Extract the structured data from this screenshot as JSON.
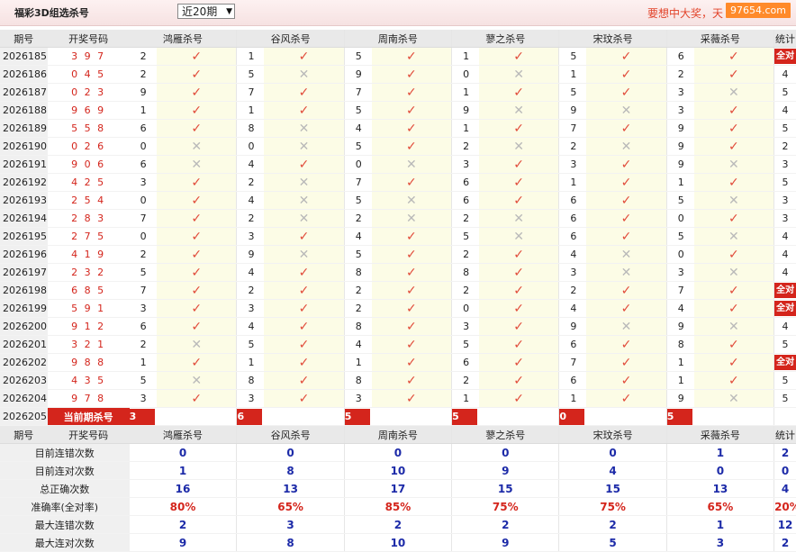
{
  "header": {
    "title": "福彩3D组选杀号",
    "period_select": "近20期",
    "slogan": "要想中大奖，天",
    "site": "97654.com"
  },
  "columns": {
    "period": "期号",
    "code": "开奖号码",
    "groups": [
      "鸿雁杀号",
      "谷风杀号",
      "周南杀号",
      "蓼之杀号",
      "宋玟杀号",
      "采薇杀号"
    ],
    "total": "统计"
  },
  "icons": {
    "right": "check-icon",
    "wrong": "cross-icon"
  },
  "labels": {
    "all_right": "全对",
    "current": "当前期杀号"
  },
  "rows": [
    {
      "period": "2026185",
      "code": "3 9 7",
      "kills": [
        2,
        1,
        5,
        1,
        5,
        6
      ],
      "marks": [
        1,
        1,
        1,
        1,
        1,
        1
      ],
      "total": "全对",
      "all": true
    },
    {
      "period": "2026186",
      "code": "0 4 5",
      "kills": [
        2,
        5,
        9,
        0,
        1,
        2
      ],
      "marks": [
        1,
        0,
        1,
        0,
        1,
        1
      ],
      "total": "4"
    },
    {
      "period": "2026187",
      "code": "0 2 3",
      "kills": [
        9,
        7,
        7,
        1,
        5,
        3
      ],
      "marks": [
        1,
        1,
        1,
        1,
        1,
        0
      ],
      "total": "5"
    },
    {
      "period": "2026188",
      "code": "9 6 9",
      "kills": [
        1,
        1,
        5,
        9,
        9,
        3
      ],
      "marks": [
        1,
        1,
        1,
        0,
        0,
        1
      ],
      "total": "4"
    },
    {
      "period": "2026189",
      "code": "5 5 8",
      "kills": [
        6,
        8,
        4,
        1,
        7,
        9
      ],
      "marks": [
        1,
        0,
        1,
        1,
        1,
        1
      ],
      "total": "5"
    },
    {
      "period": "2026190",
      "code": "0 2 6",
      "kills": [
        0,
        0,
        5,
        2,
        2,
        9
      ],
      "marks": [
        0,
        0,
        1,
        0,
        0,
        1
      ],
      "total": "2"
    },
    {
      "period": "2026191",
      "code": "9 0 6",
      "kills": [
        6,
        4,
        0,
        3,
        3,
        9
      ],
      "marks": [
        0,
        1,
        0,
        1,
        1,
        0
      ],
      "total": "3"
    },
    {
      "period": "2026192",
      "code": "4 2 5",
      "kills": [
        3,
        2,
        7,
        6,
        1,
        1
      ],
      "marks": [
        1,
        0,
        1,
        1,
        1,
        1
      ],
      "total": "5"
    },
    {
      "period": "2026193",
      "code": "2 5 4",
      "kills": [
        0,
        4,
        5,
        6,
        6,
        5
      ],
      "marks": [
        1,
        0,
        0,
        1,
        1,
        0
      ],
      "total": "3"
    },
    {
      "period": "2026194",
      "code": "2 8 3",
      "kills": [
        7,
        2,
        2,
        2,
        6,
        0
      ],
      "marks": [
        1,
        0,
        0,
        0,
        1,
        1
      ],
      "total": "3"
    },
    {
      "period": "2026195",
      "code": "2 7 5",
      "kills": [
        0,
        3,
        4,
        5,
        6,
        5
      ],
      "marks": [
        1,
        1,
        1,
        0,
        1,
        0
      ],
      "total": "4"
    },
    {
      "period": "2026196",
      "code": "4 1 9",
      "kills": [
        2,
        9,
        5,
        2,
        4,
        0
      ],
      "marks": [
        1,
        0,
        1,
        1,
        0,
        1
      ],
      "total": "4"
    },
    {
      "period": "2026197",
      "code": "2 3 2",
      "kills": [
        5,
        4,
        8,
        8,
        3,
        3
      ],
      "marks": [
        1,
        1,
        1,
        1,
        0,
        0
      ],
      "total": "4"
    },
    {
      "period": "2026198",
      "code": "6 8 5",
      "kills": [
        7,
        2,
        2,
        2,
        2,
        7
      ],
      "marks": [
        1,
        1,
        1,
        1,
        1,
        1
      ],
      "total": "全对",
      "all": true
    },
    {
      "period": "2026199",
      "code": "5 9 1",
      "kills": [
        3,
        3,
        2,
        0,
        4,
        4
      ],
      "marks": [
        1,
        1,
        1,
        1,
        1,
        1
      ],
      "total": "全对",
      "all": true
    },
    {
      "period": "2026200",
      "code": "9 1 2",
      "kills": [
        6,
        4,
        8,
        3,
        9,
        9
      ],
      "marks": [
        1,
        1,
        1,
        1,
        0,
        0
      ],
      "total": "4"
    },
    {
      "period": "2026201",
      "code": "3 2 1",
      "kills": [
        2,
        5,
        4,
        5,
        6,
        8
      ],
      "marks": [
        0,
        1,
        1,
        1,
        1,
        1
      ],
      "total": "5"
    },
    {
      "period": "2026202",
      "code": "9 8 8",
      "kills": [
        1,
        1,
        1,
        6,
        7,
        1
      ],
      "marks": [
        1,
        1,
        1,
        1,
        1,
        1
      ],
      "total": "全对",
      "all": true
    },
    {
      "period": "2026203",
      "code": "4 3 5",
      "kills": [
        5,
        8,
        8,
        2,
        6,
        1
      ],
      "marks": [
        0,
        1,
        1,
        1,
        1,
        1
      ],
      "total": "5"
    },
    {
      "period": "2026204",
      "code": "9 7 8",
      "kills": [
        3,
        3,
        3,
        1,
        1,
        9
      ],
      "marks": [
        1,
        1,
        1,
        1,
        1,
        0
      ],
      "total": "5"
    }
  ],
  "current": {
    "period": "2026205",
    "kills": [
      3,
      6,
      5,
      5,
      0,
      5
    ]
  },
  "stats": [
    {
      "label": "目前连错次数",
      "values": [
        "0",
        "0",
        "0",
        "0",
        "0",
        "1",
        "2"
      ],
      "pct": false
    },
    {
      "label": "目前连对次数",
      "values": [
        "1",
        "8",
        "10",
        "9",
        "4",
        "0",
        "0"
      ],
      "pct": false
    },
    {
      "label": "总正确次数",
      "values": [
        "16",
        "13",
        "17",
        "15",
        "15",
        "13",
        "4"
      ],
      "pct": false
    },
    {
      "label": "准确率(全对率)",
      "values": [
        "80%",
        "65%",
        "85%",
        "75%",
        "75%",
        "65%",
        "20%"
      ],
      "pct": true
    },
    {
      "label": "最大连错次数",
      "values": [
        "2",
        "3",
        "2",
        "2",
        "2",
        "1",
        "12"
      ],
      "pct": false
    },
    {
      "label": "最大连对次数",
      "values": [
        "9",
        "8",
        "10",
        "9",
        "5",
        "3",
        "2"
      ],
      "pct": false
    }
  ]
}
